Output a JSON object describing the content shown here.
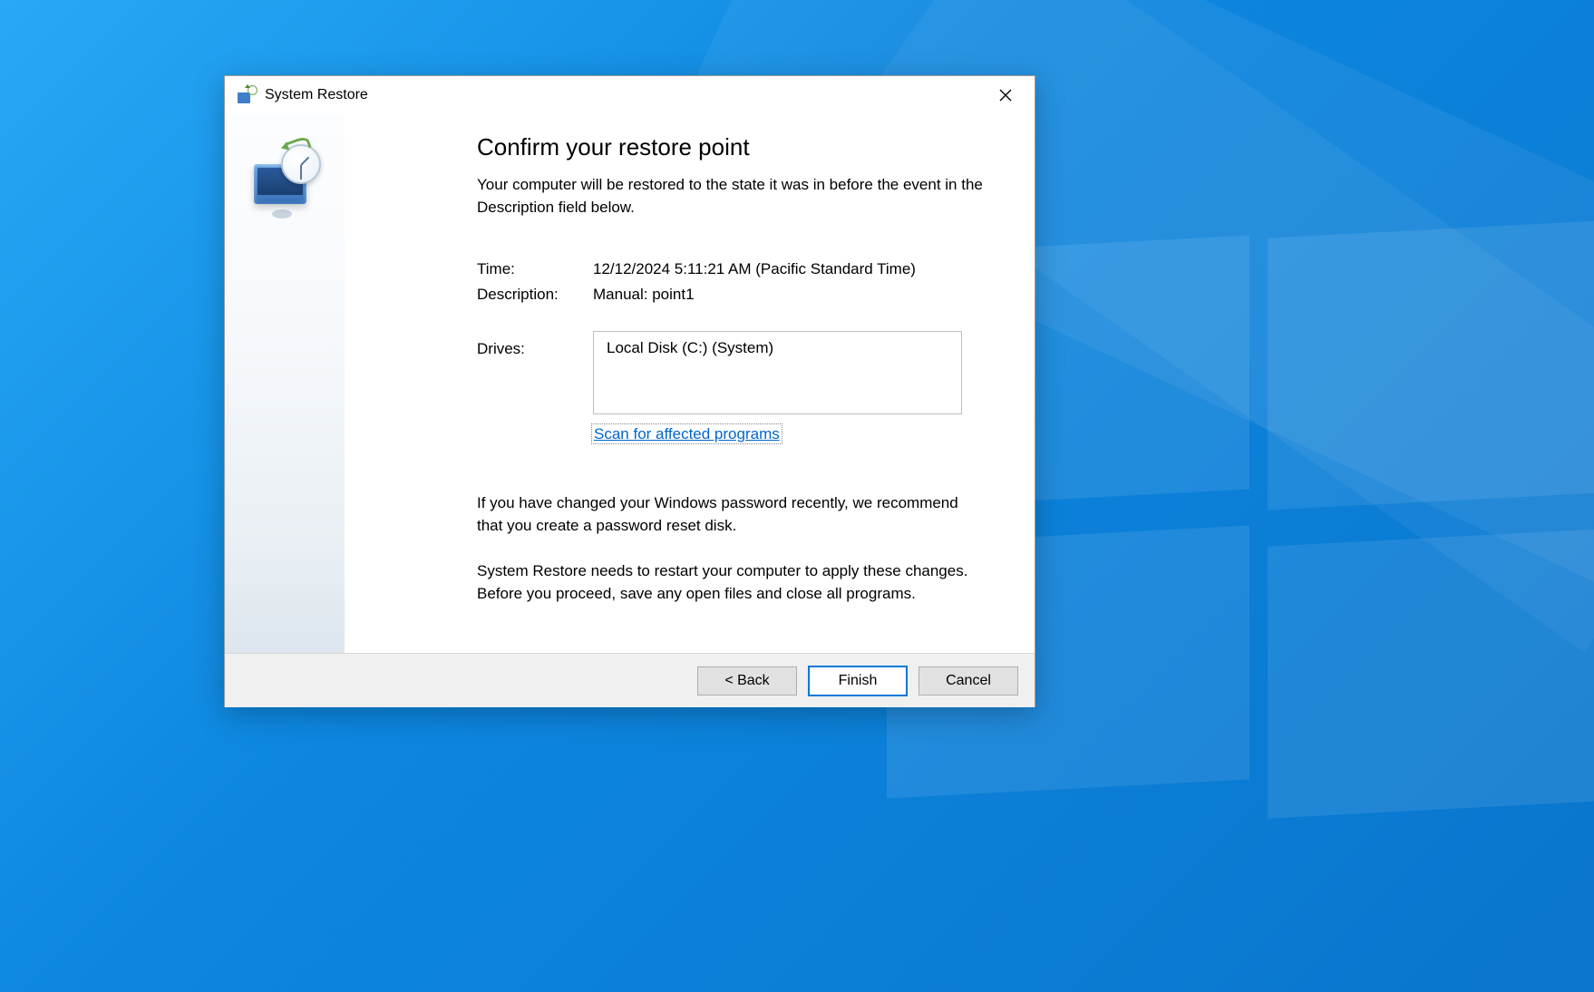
{
  "window": {
    "title": "System Restore"
  },
  "content": {
    "heading": "Confirm your restore point",
    "subtext": "Your computer will be restored to the state it was in before the event in the Description field below.",
    "time_label": "Time:",
    "time_value": "12/12/2024 5:11:21 AM (Pacific Standard Time)",
    "description_label": "Description:",
    "description_value": "Manual: point1",
    "drives_label": "Drives:",
    "drives_value": "Local Disk (C:) (System)",
    "scan_link": "Scan for affected programs",
    "password_note": "If you have changed your Windows password recently, we recommend that you create a password reset disk.",
    "restart_note": "System Restore needs to restart your computer to apply these changes. Before you proceed, save any open files and close all programs."
  },
  "buttons": {
    "back": "< Back",
    "finish": "Finish",
    "cancel": "Cancel"
  }
}
